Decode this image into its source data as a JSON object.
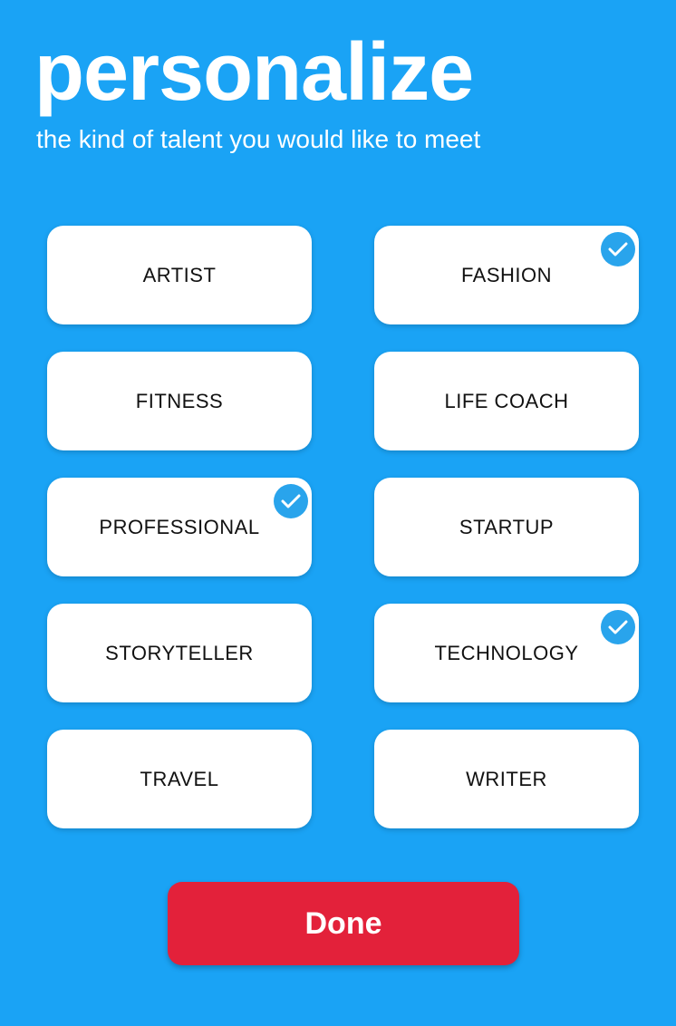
{
  "header": {
    "title": "personalize",
    "subtitle": "the kind of talent you would like to meet"
  },
  "categories": [
    {
      "label": "ARTIST",
      "selected": false
    },
    {
      "label": "FASHION",
      "selected": true
    },
    {
      "label": "FITNESS",
      "selected": false
    },
    {
      "label": "LIFE COACH",
      "selected": false
    },
    {
      "label": "PROFESSIONAL",
      "selected": true
    },
    {
      "label": "STARTUP",
      "selected": false
    },
    {
      "label": "STORYTELLER",
      "selected": false
    },
    {
      "label": "TECHNOLOGY",
      "selected": true
    },
    {
      "label": "TRAVEL",
      "selected": false
    },
    {
      "label": "WRITER",
      "selected": false
    }
  ],
  "icons": {
    "selected_check": "check-circle-icon"
  },
  "actions": {
    "done_label": "Done"
  },
  "colors": {
    "background": "#1aa3f5",
    "card": "#ffffff",
    "check_badge": "#29a4ec",
    "done_button": "#e3213a"
  }
}
